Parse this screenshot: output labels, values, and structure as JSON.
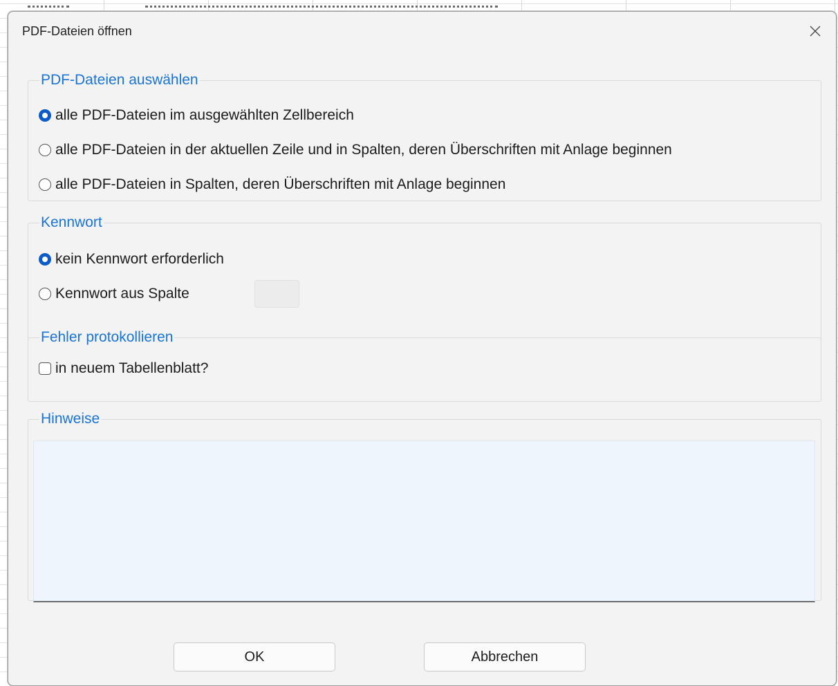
{
  "dialog": {
    "title": "PDF-Dateien öffnen",
    "close_icon": "close-icon"
  },
  "select_group": {
    "legend": "PDF-Dateien auswählen",
    "options": [
      {
        "label": "alle PDF-Dateien im ausgewählten Zellbereich",
        "checked": true
      },
      {
        "label": "alle PDF-Dateien in der aktuellen Zeile und in Spalten, deren Überschriften mit Anlage beginnen",
        "checked": false
      },
      {
        "label": "alle PDF-Dateien in Spalten, deren Überschriften mit Anlage beginnen",
        "checked": false
      }
    ]
  },
  "password_group": {
    "legend": "Kennwort",
    "options": [
      {
        "label": "kein Kennwort erforderlich",
        "checked": true
      },
      {
        "label": "Kennwort aus Spalte",
        "checked": false
      }
    ],
    "column_value": ""
  },
  "log_group": {
    "legend": "Fehler protokollieren",
    "checkbox_label": "in neuem Tabellenblatt?",
    "checked": false
  },
  "notes_group": {
    "legend": "Hinweise",
    "text": ""
  },
  "buttons": {
    "ok": "OK",
    "cancel": "Abbrechen"
  },
  "colors": {
    "accent": "#1a74d6",
    "radio_checked": "#0b5cc8",
    "notes_bg": "#eef5fd"
  }
}
